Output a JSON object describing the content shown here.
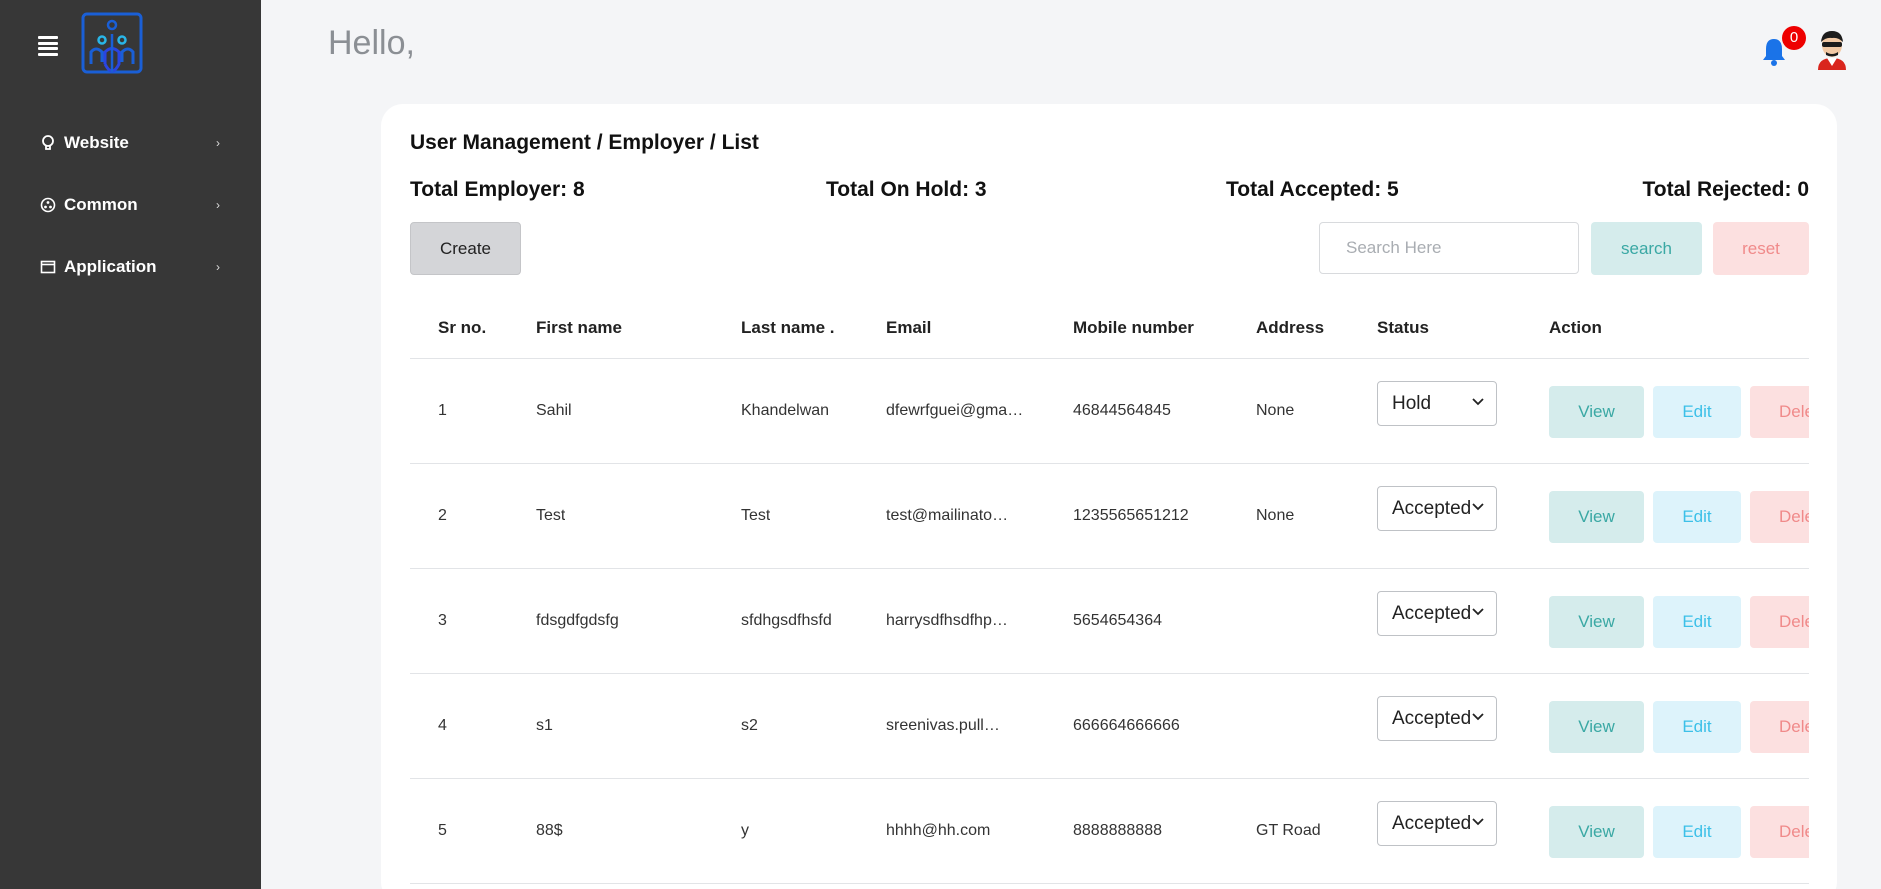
{
  "sidebar": {
    "items": [
      {
        "label": "Website",
        "icon": "bulb-icon"
      },
      {
        "label": "Common",
        "icon": "circle-dots-icon"
      },
      {
        "label": "Application",
        "icon": "window-icon"
      }
    ]
  },
  "header": {
    "greeting": "Hello,",
    "notification_count": "0"
  },
  "page": {
    "breadcrumb": "User Management / Employer / List",
    "stats": {
      "total_employer": "Total Employer: 8",
      "total_on_hold": "Total On Hold: 3",
      "total_accepted": "Total Accepted: 5",
      "total_rejected": "Total Rejected: 0"
    },
    "create_label": "Create",
    "search_placeholder": "Search Here",
    "search_label": "search",
    "reset_label": "reset"
  },
  "table": {
    "columns": [
      "Sr no.",
      "First name",
      "Last name .",
      "Email",
      "Mobile number",
      "Address",
      "Status",
      "Action"
    ],
    "rows": [
      {
        "sr": "1",
        "first": "Sahil",
        "last": "Khandelwan",
        "email": "dfewrfguei@gma…",
        "mobile": "46844564845",
        "address": "None",
        "status": "Hold"
      },
      {
        "sr": "2",
        "first": "Test",
        "last": "Test",
        "email": "test@mailinato…",
        "mobile": "1235565651212",
        "address": "None",
        "status": "Accepted"
      },
      {
        "sr": "3",
        "first": "fdsgdfgdsfg",
        "last": "sfdhgsdfhsfd",
        "email": "harrysdfhsdfhp…",
        "mobile": "5654654364",
        "address": "",
        "status": "Accepted"
      },
      {
        "sr": "4",
        "first": "s1",
        "last": "s2",
        "email": "sreenivas.pull…",
        "mobile": "666664666666",
        "address": "",
        "status": "Accepted"
      },
      {
        "sr": "5",
        "first": "88$",
        "last": "y",
        "email": "hhhh@hh.com",
        "mobile": "8888888888",
        "address": "GT Road",
        "status": "Accepted"
      }
    ],
    "actions": {
      "view": "View",
      "edit": "Edit",
      "delete": "Delete"
    }
  },
  "colors": {
    "sidebar_bg": "#373737",
    "view_bg": "#d5ecec",
    "edit_bg": "#ddf3fb",
    "delete_bg": "#fce0e0",
    "bell": "#1a73e8",
    "badge": "#ee0000"
  }
}
